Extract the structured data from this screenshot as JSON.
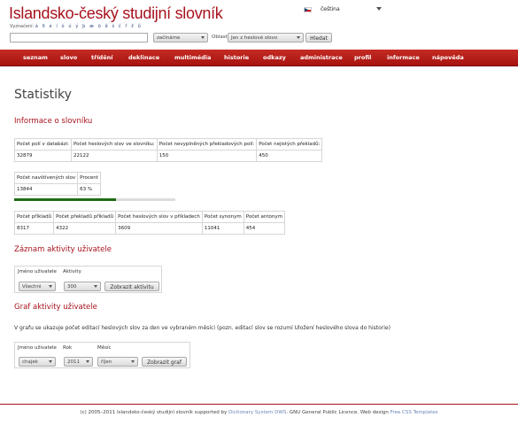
{
  "header": {
    "title": "Islandsko-český studijní slovník",
    "vyznaceni_label": "Vyznačení:",
    "special_chars": "á ð é í ó ú ý þ æ ö ě š č ř ž ů",
    "language": "čeština"
  },
  "search": {
    "input_value": "",
    "scope": "začínáme",
    "area_label": "Oblast:",
    "area_value": "Jen z heslové slovo",
    "find_button": "Hledat"
  },
  "nav": {
    "items": [
      "seznam",
      "slovo",
      "třídění",
      "deklinace",
      "multimédia",
      "historie",
      "odkazy",
      "administrace",
      "profil",
      "informace",
      "nápověda"
    ]
  },
  "page": {
    "title": "Statistiky"
  },
  "dictionary_info": {
    "heading": "Informace o slovníku",
    "table1": {
      "headers": [
        "Počet polí v databázi:",
        "Počet heslových slov ve slovníku:",
        "Počet nevyplněných překladových polí:",
        "Počet nejistých překladů:"
      ],
      "values": [
        "32879",
        "22122",
        "150",
        "450"
      ]
    },
    "table2": {
      "headers": [
        "Počet navštívených slov",
        "Procent"
      ],
      "values": [
        "13844",
        "63 %"
      ]
    },
    "progress_percent": 63,
    "table3": {
      "headers": [
        "Počet příkladů",
        "Počet překladů příkladů",
        "Počet heslových slov v příkladech",
        "Počet synonym",
        "Počet antonym"
      ],
      "values": [
        "8317",
        "4322",
        "3609",
        "11041",
        "454"
      ]
    }
  },
  "activity_log": {
    "heading": "Záznam aktivity uživatele",
    "user_label": "Jméno uživatele",
    "activity_label": "Aktivity",
    "user_value": "Všechni",
    "activity_value": "300",
    "show_button": "Zobrazit aktivitu"
  },
  "activity_graph": {
    "heading": "Graf aktivity uživatele",
    "description": "V grafu se ukazuje počet editací heslových slov za den ve vybraném měsíci (pozn. editací slov se rozumí Uložení heslového slova do historie)",
    "user_label": "Jméno uživatele",
    "year_label": "Rok",
    "month_label": "Měsíc",
    "user_value": "chajek",
    "year_value": "2011",
    "month_value": "říjen",
    "show_button": "Zobrazit graf"
  },
  "footer": {
    "prefix": "(c) 2005–2011 Islandsko-český studijní slovník supported by",
    "link1": "Dictionary System DWS",
    "middle": ". GNU General Public Licence. Web design",
    "link2": "Free CSS Templates"
  }
}
